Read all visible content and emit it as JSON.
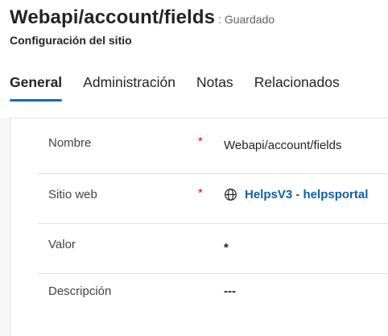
{
  "header": {
    "title": "Webapi/account/fields",
    "save_status": ": Guardado",
    "entity_type": "Configuración del sitio"
  },
  "tabs": [
    {
      "label": "General",
      "active": true
    },
    {
      "label": "Administración",
      "active": false
    },
    {
      "label": "Notas",
      "active": false
    },
    {
      "label": "Relacionados",
      "active": false
    }
  ],
  "form": {
    "fields": [
      {
        "label": "Nombre",
        "required": "*",
        "value": "Webapi/account/fields"
      },
      {
        "label": "Sitio web",
        "required": "*",
        "value": "HelpsV3 - helpsportal",
        "icon": "globe-icon"
      },
      {
        "label": "Valor",
        "value": "*"
      },
      {
        "label": "Descripción",
        "value": "---"
      }
    ]
  },
  "colors": {
    "accent": "#0f6cbd",
    "link": "#115ea3",
    "required": "#c50f1f"
  }
}
